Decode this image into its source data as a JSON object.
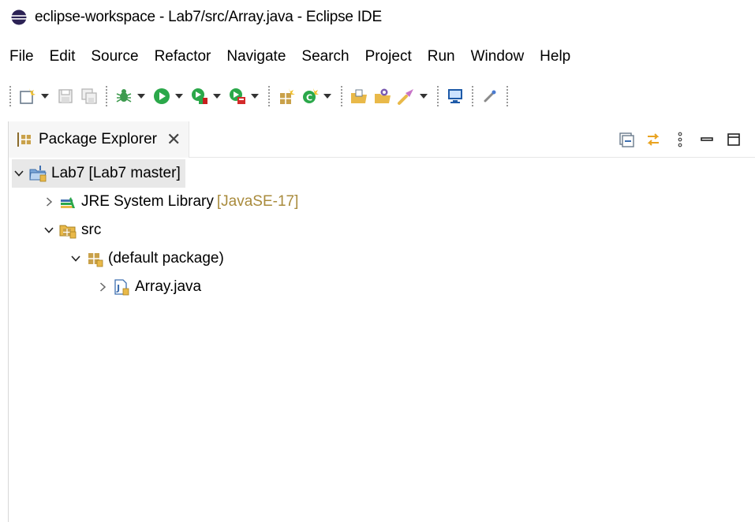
{
  "window": {
    "title": "eclipse-workspace - Lab7/src/Array.java - Eclipse IDE"
  },
  "menu": [
    "File",
    "Edit",
    "Source",
    "Refactor",
    "Navigate",
    "Search",
    "Project",
    "Run",
    "Window",
    "Help"
  ],
  "view": {
    "tab_label": "Package Explorer",
    "close_glyph": "✕"
  },
  "tree": {
    "project": {
      "label": "Lab7 [Lab7 master]"
    },
    "jre": {
      "label": "JRE System Library",
      "decoration": "[JavaSE-17]"
    },
    "src": {
      "label": "src"
    },
    "package": {
      "label": "(default package)"
    },
    "file": {
      "label": "Array.java"
    }
  },
  "colors": {
    "selection": "#e8e8e8",
    "decoration": "#a98b3c",
    "run_green": "#2ba84a",
    "folder_yellow": "#e9b949"
  },
  "icons": {
    "app": "eclipse-icon",
    "tab": "package-explorer-icon"
  }
}
